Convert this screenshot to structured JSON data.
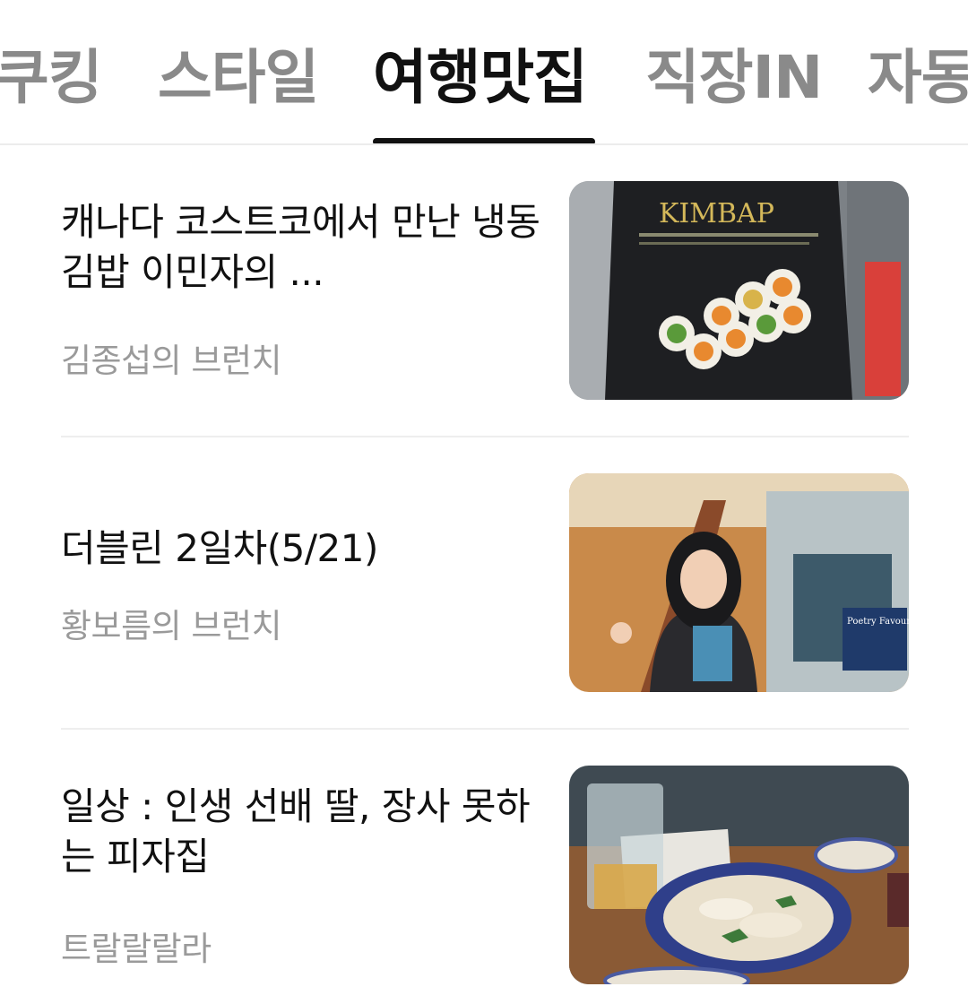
{
  "tabs": [
    {
      "label": "쿠킹"
    },
    {
      "label": "스타일"
    },
    {
      "label": "여행맛집",
      "active": true
    },
    {
      "label": "직장IN"
    },
    {
      "label": "자동"
    }
  ],
  "articles": [
    {
      "title": "캐나다 코스트코에서 만난 냉동 김밥 이민자의 ...",
      "author": "김종섭의 브런치",
      "thumb_label": "KIMBAP"
    },
    {
      "title": "더블린 2일차(5/21)",
      "author": "황보름의 브런치",
      "thumb_label": "Poetry Favourites..."
    },
    {
      "title": "일상 : 인생 선배 딸, 장사 못하는 피자집",
      "author": "트랄랄랄라"
    }
  ]
}
